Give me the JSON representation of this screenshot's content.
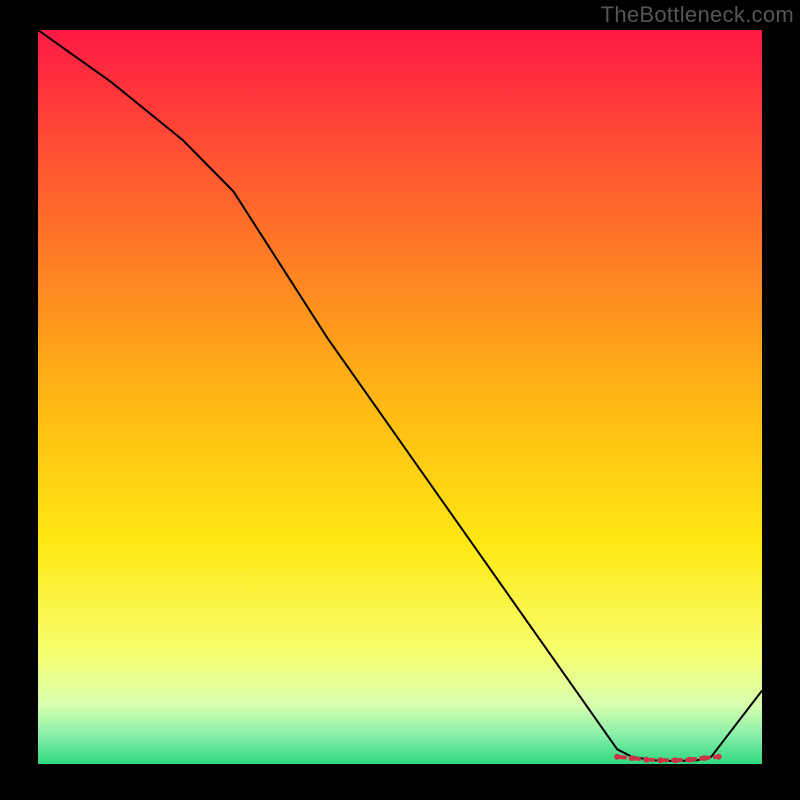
{
  "watermark": "TheBottleneck.com",
  "chart_data": {
    "type": "line",
    "title": "",
    "xlabel": "",
    "ylabel": "",
    "xlim": [
      0,
      100
    ],
    "ylim": [
      0,
      100
    ],
    "series": [
      {
        "name": "curve",
        "x": [
          0,
          10,
          20,
          27,
          40,
          55,
          70,
          80,
          82,
          85,
          88,
          91,
          93,
          100
        ],
        "y": [
          100,
          93,
          85,
          78,
          58,
          37,
          16,
          2,
          1,
          0.5,
          0.4,
          0.5,
          1,
          10
        ],
        "stroke": "#000000",
        "stroke_width": 2
      }
    ],
    "markers": {
      "name": "bottleneck-zone",
      "x": [
        80,
        82,
        84,
        86,
        88,
        90,
        92,
        94
      ],
      "y": [
        1.0,
        0.8,
        0.6,
        0.5,
        0.5,
        0.6,
        0.8,
        1.0
      ],
      "color": "#cc3344",
      "size": 6
    },
    "background_gradient": {
      "stops": [
        {
          "offset": 0.0,
          "color": "#ff1a44"
        },
        {
          "offset": 0.25,
          "color": "#ff6a2a"
        },
        {
          "offset": 0.5,
          "color": "#ffb614"
        },
        {
          "offset": 0.7,
          "color": "#ffe812"
        },
        {
          "offset": 0.85,
          "color": "#f6ff70"
        },
        {
          "offset": 0.92,
          "color": "#d7ffb0"
        },
        {
          "offset": 0.96,
          "color": "#88f0a8"
        },
        {
          "offset": 1.0,
          "color": "#2fd880"
        }
      ]
    }
  }
}
